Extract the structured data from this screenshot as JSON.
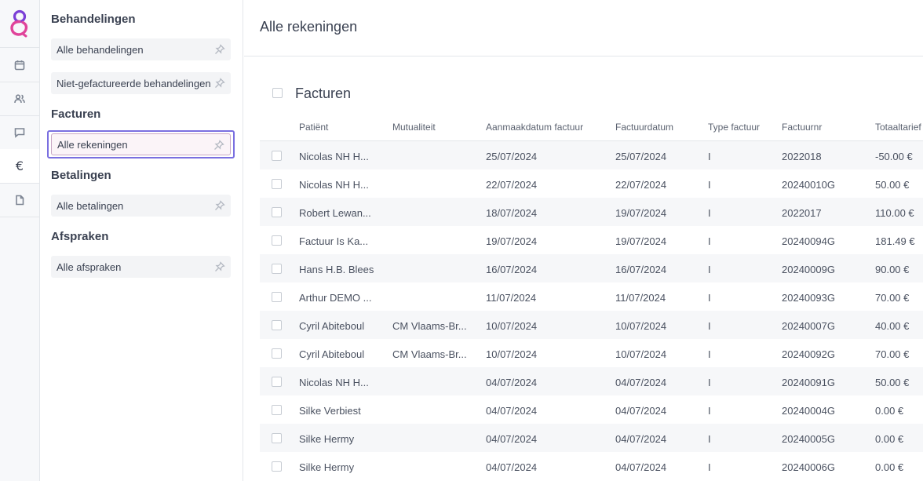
{
  "colors": {
    "accent": "#7a6fe0",
    "logo_pink": "#e0449a",
    "logo_purple": "#7b3fd6"
  },
  "rail": {
    "items": [
      {
        "name": "calendar-icon"
      },
      {
        "name": "users-icon"
      },
      {
        "name": "chat-icon"
      },
      {
        "name": "euro-icon",
        "glyph": "€"
      },
      {
        "name": "document-icon"
      }
    ]
  },
  "nav": {
    "groups": [
      {
        "title": "Behandelingen",
        "items": [
          "Alle behandelingen",
          "Niet-gefactureerde behandelingen"
        ]
      },
      {
        "title": "Facturen",
        "items": [
          "Alle rekeningen"
        ]
      },
      {
        "title": "Betalingen",
        "items": [
          "Alle betalingen"
        ]
      },
      {
        "title": "Afspraken",
        "items": [
          "Alle afspraken"
        ]
      }
    ]
  },
  "main": {
    "title": "Alle rekeningen",
    "section_title": "Facturen",
    "columns": [
      "Patiënt",
      "Mutualiteit",
      "Aanmaakdatum factuur",
      "Factuurdatum",
      "Type factuur",
      "Factuurnr",
      "Totaaltarief"
    ],
    "rows": [
      [
        "Nicolas NH H...",
        "",
        "25/07/2024",
        "25/07/2024",
        "I",
        "2022018",
        "-50.00 €"
      ],
      [
        "Nicolas NH H...",
        "",
        "22/07/2024",
        "22/07/2024",
        "I",
        "20240010G",
        "50.00 €"
      ],
      [
        "Robert Lewan...",
        "",
        "18/07/2024",
        "19/07/2024",
        "I",
        "2022017",
        "110.00 €"
      ],
      [
        "Factuur Is Ka...",
        "",
        "19/07/2024",
        "19/07/2024",
        "I",
        "20240094G",
        "181.49 €"
      ],
      [
        "Hans H.B. Blees",
        "",
        "16/07/2024",
        "16/07/2024",
        "I",
        "20240009G",
        "90.00 €"
      ],
      [
        "Arthur DEMO ...",
        "",
        "11/07/2024",
        "11/07/2024",
        "I",
        "20240093G",
        "70.00 €"
      ],
      [
        "Cyril Abiteboul",
        "CM Vlaams-Br...",
        "10/07/2024",
        "10/07/2024",
        "I",
        "20240007G",
        "40.00 €"
      ],
      [
        "Cyril Abiteboul",
        "CM Vlaams-Br...",
        "10/07/2024",
        "10/07/2024",
        "I",
        "20240092G",
        "70.00 €"
      ],
      [
        "Nicolas NH H...",
        "",
        "04/07/2024",
        "04/07/2024",
        "I",
        "20240091G",
        "50.00 €"
      ],
      [
        "Silke Verbiest",
        "",
        "04/07/2024",
        "04/07/2024",
        "I",
        "20240004G",
        "0.00 €"
      ],
      [
        "Silke Hermy",
        "",
        "04/07/2024",
        "04/07/2024",
        "I",
        "20240005G",
        "0.00 €"
      ],
      [
        "Silke Hermy",
        "",
        "04/07/2024",
        "04/07/2024",
        "I",
        "20240006G",
        "0.00 €"
      ]
    ]
  }
}
